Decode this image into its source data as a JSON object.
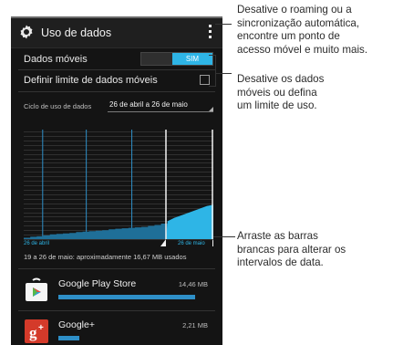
{
  "screen": {
    "title": "Uso de dados",
    "mobile_data": {
      "label": "Dados móveis",
      "toggle_value": "SIM",
      "enabled": true
    },
    "data_limit": {
      "label": "Definir limite de dados móveis",
      "checked": false
    },
    "cycle": {
      "label": "Ciclo de uso de dados",
      "value": "26 de abril a 26 de maio"
    },
    "chart_axis": {
      "start": "26 de abril",
      "end": "26 de maio"
    },
    "summary": "19 a 26 de maio: aproximadamente 16,67 MB usados",
    "apps": [
      {
        "name": "Google Play Store",
        "size": "14,46 MB",
        "usage_fraction": 1.0
      },
      {
        "name": "Google+",
        "size": "2,21 MB",
        "usage_fraction": 0.15
      }
    ]
  },
  "callouts": {
    "roaming": [
      "Desative o roaming ou a",
      "sincronização automática,",
      "encontre um ponto de",
      "acesso móvel e muito mais."
    ],
    "data": [
      "Desative os dados",
      "móveis ou defina",
      "um limite de uso."
    ],
    "bars": [
      "Arraste as barras",
      "brancas para alterar os",
      "intervalos de data."
    ]
  },
  "colors": {
    "accent": "#2eb5e6",
    "bar": "#2e8fc7",
    "background": "#141414"
  },
  "chart_data": {
    "type": "area",
    "title": "",
    "xlabel": "",
    "ylabel": "",
    "x_range": [
      "26 de abril",
      "26 de maio"
    ],
    "series": [
      {
        "values": [
          0.3,
          0.5,
          0.6,
          0.8,
          1.0,
          1.1,
          1.2,
          1.3,
          1.5,
          1.6,
          1.7,
          1.8,
          1.9,
          2.1,
          2.2,
          2.3,
          2.4,
          2.5,
          2.6,
          2.8,
          3.0,
          3.3,
          3.8,
          4.5,
          5.0,
          5.5,
          6.0,
          6.5,
          7.0,
          7.3
        ]
      }
    ],
    "ylim": [
      0,
      24
    ],
    "selection": {
      "start_fraction": 0.75,
      "end_fraction": 1.0
    },
    "grid": true,
    "icons": {
      "gear": "gear-icon",
      "overflow": "overflow-menu-icon",
      "check": "checkbox-icon"
    }
  }
}
